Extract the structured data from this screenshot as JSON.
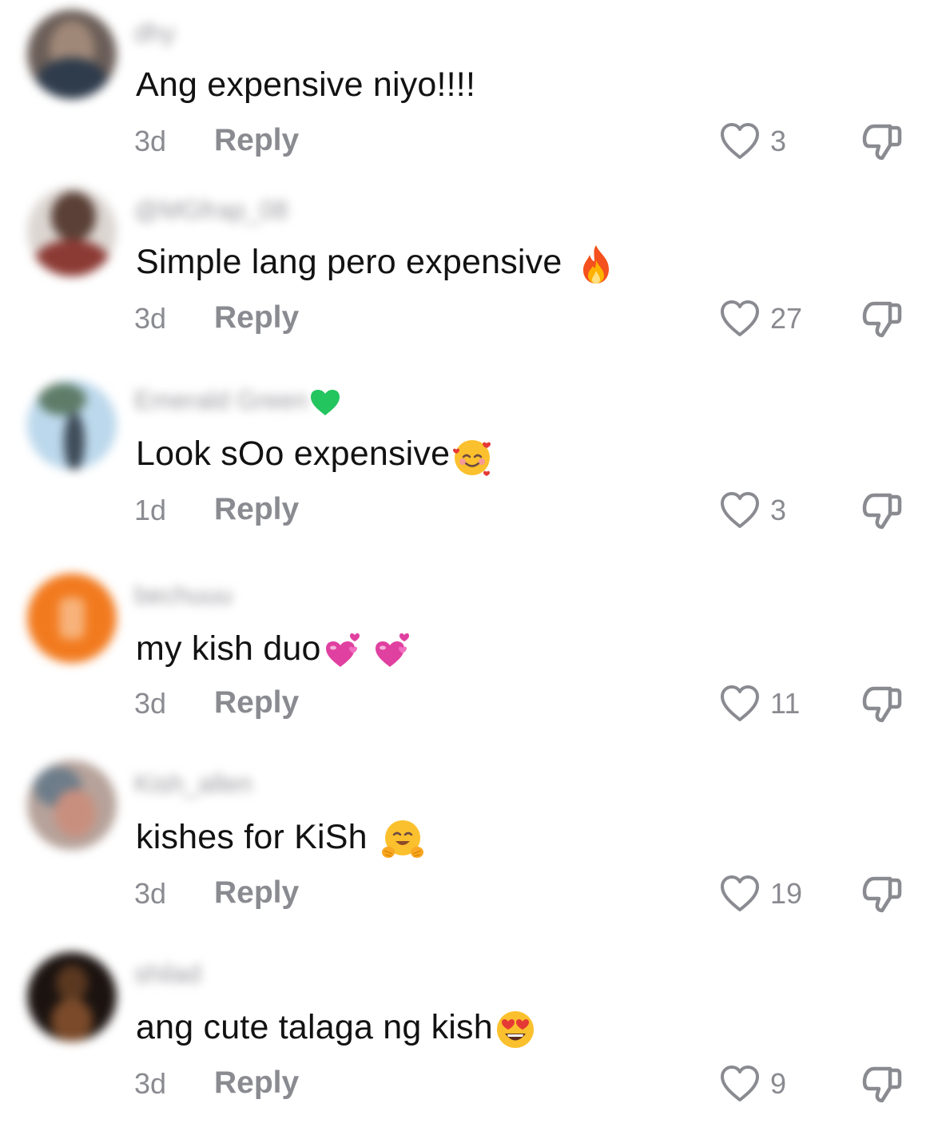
{
  "comments": [
    {
      "username": "dhy",
      "text": "Ang expensive niyo!!!!",
      "emojis": [],
      "time": "3d",
      "reply_label": "Reply",
      "likes": "3",
      "avatar_colors": [
        "#6b5e58",
        "#9e8a7c",
        "#3a4b5e"
      ]
    },
    {
      "username": "@MGfrap_08",
      "text": "Simple lang pero expensive ",
      "emojis": [
        "fire"
      ],
      "time": "3d",
      "reply_label": "Reply",
      "likes": "27",
      "avatar_colors": [
        "#d6d0cc",
        "#8a6a5a",
        "#3e2a24"
      ]
    },
    {
      "username": "Emerald Green",
      "text": "Look sOo expensive",
      "emojis": [
        "smiling-face-with-hearts"
      ],
      "time": "1d",
      "reply_label": "Reply",
      "likes": "3",
      "avatar_colors": [
        "#b9d6ea",
        "#7aa6c8",
        "#4a5e6e"
      ]
    },
    {
      "username": "bechuuu",
      "text": "my kish duo",
      "emojis": [
        "two-hearts",
        "two-hearts"
      ],
      "time": "3d",
      "reply_label": "Reply",
      "likes": "11",
      "avatar_colors": [
        "#f27a1e",
        "#f7a869",
        "#f3872f"
      ]
    },
    {
      "username": "Kish_allen",
      "text": "kishes for KiSh ",
      "emojis": [
        "hugging-face"
      ],
      "time": "3d",
      "reply_label": "Reply",
      "likes": "19",
      "avatar_colors": [
        "#a9928a",
        "#c98f7e",
        "#6e7d8a"
      ]
    },
    {
      "username": "shilad",
      "text": "ang cute talaga ng kish",
      "emojis": [
        "heart-eyes"
      ],
      "time": "3d",
      "reply_label": "Reply",
      "likes": "9",
      "avatar_colors": [
        "#1b1310",
        "#7a4a2a",
        "#2a1a12"
      ]
    }
  ],
  "colors": {
    "text": "#121212",
    "meta": "#8a8b91",
    "username": "#9a9a9f",
    "verified_badge": "#22c55e"
  }
}
